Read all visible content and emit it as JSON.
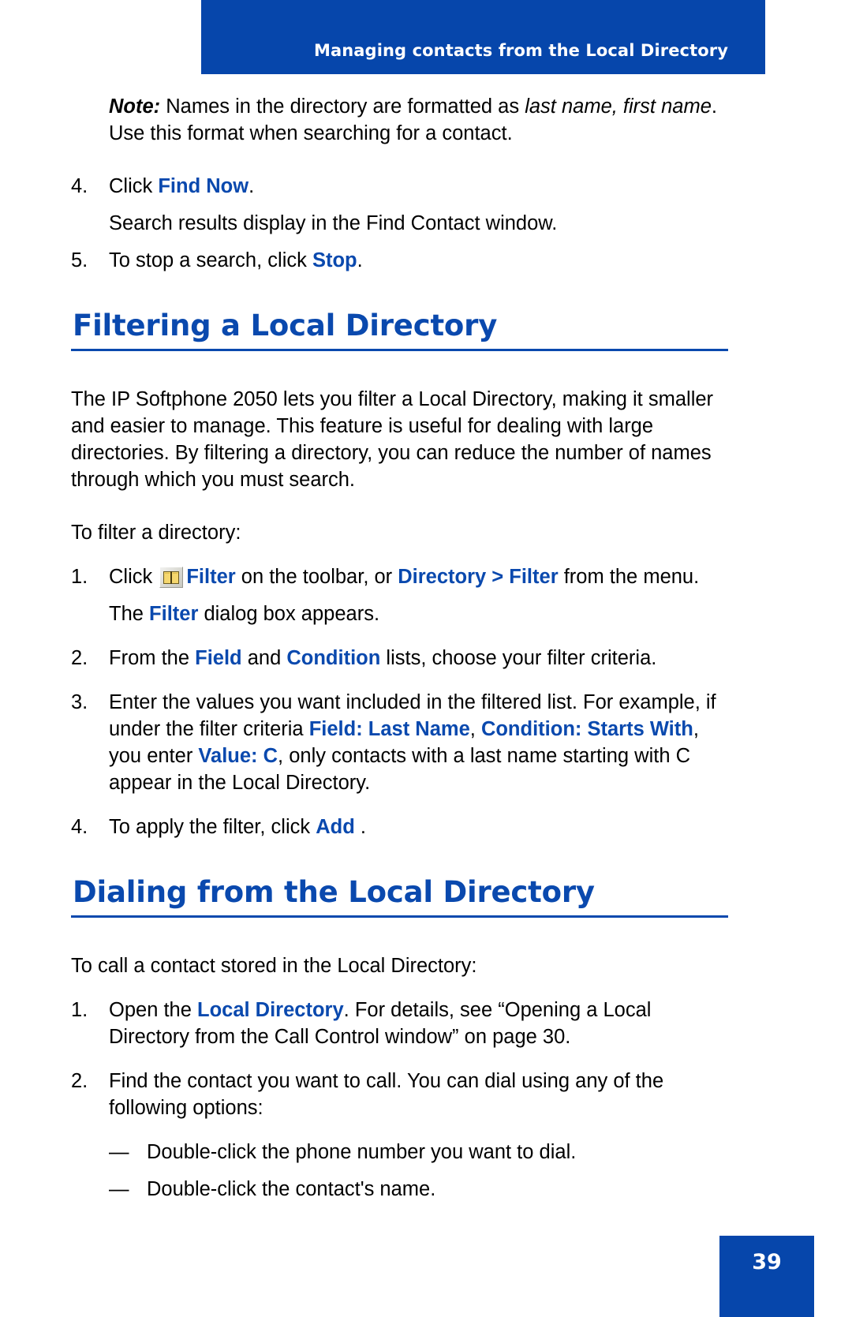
{
  "header": {
    "title": "Managing contacts from the Local Directory",
    "banner_color": "#0646ab"
  },
  "colors": {
    "accent_blue": "#0a49ae",
    "banner_blue": "#0646ab",
    "body_text": "#000000"
  },
  "note": {
    "label": "Note:",
    "line1_rest": " Names in the directory are formatted as ",
    "italic_phrase": "last name, first name",
    "line1_tail": ".",
    "line2": "Use this format when searching for a contact."
  },
  "search_steps": [
    {
      "number": "4.",
      "pre": "Click ",
      "bold": "Find Now",
      "post": "."
    },
    {
      "number": "5.",
      "pre": "To stop a search, click ",
      "bold": "Stop",
      "post": "."
    }
  ],
  "search_result_note": "Search results display in the Find Contact window.",
  "filtering_section": {
    "heading": "Filtering a Local Directory",
    "intro": "The IP Softphone 2050 lets you filter a Local Directory, making it smaller and easier to manage. This feature is useful for dealing with large directories. By filtering a directory, you can reduce the number of names through which you must search.",
    "lead_in": "To filter a directory:",
    "step1": {
      "number": "1.",
      "icon": "book-icon",
      "pre": "Click ",
      "bold1": "Filter",
      "mid1": " on the toolbar, or ",
      "bold2": "Directory > Filter",
      "tail": " from the menu."
    },
    "step1_result": {
      "pre": "The ",
      "bold": "Filter",
      "post": " dialog box appears."
    },
    "step2": {
      "number": "2.",
      "pre": "From the ",
      "bold1": "Field",
      "mid": " and ",
      "bold2": "Condition",
      "tail": " lists, choose your filter criteria."
    },
    "step3": {
      "number": "3.",
      "part1": "Enter the values you want included in the filtered list. For example, if under the filter criteria ",
      "bold1": "Field: Last Name",
      "sep1": ", ",
      "bold2": "Condition: Starts With",
      "sep2": ", you enter ",
      "bold3": "Value: C",
      "tail": ", only contacts with a last name starting with C appear in the Local Directory."
    },
    "step4": {
      "number": "4.",
      "pre": "To apply the filter, click ",
      "bold": "Add",
      "post": " ."
    }
  },
  "dialing_section": {
    "heading": "Dialing from the Local Directory",
    "lead_in": "To call a contact stored in the Local Directory:",
    "step1": {
      "number": "1.",
      "pre": "Open the ",
      "bold": "Local Directory",
      "post": ". For details, see “Opening a Local Directory from the Call Control window” on page 30."
    },
    "step2": {
      "number": "2.",
      "text": "Find the contact you want to call. You can dial using any of the following options:"
    },
    "sub_bullets": [
      {
        "marker": "—",
        "text": "Double-click the phone number you want to dial."
      },
      {
        "marker": "—",
        "text": "Double-click the contact's name."
      }
    ]
  },
  "footer": {
    "page_number": "39"
  }
}
